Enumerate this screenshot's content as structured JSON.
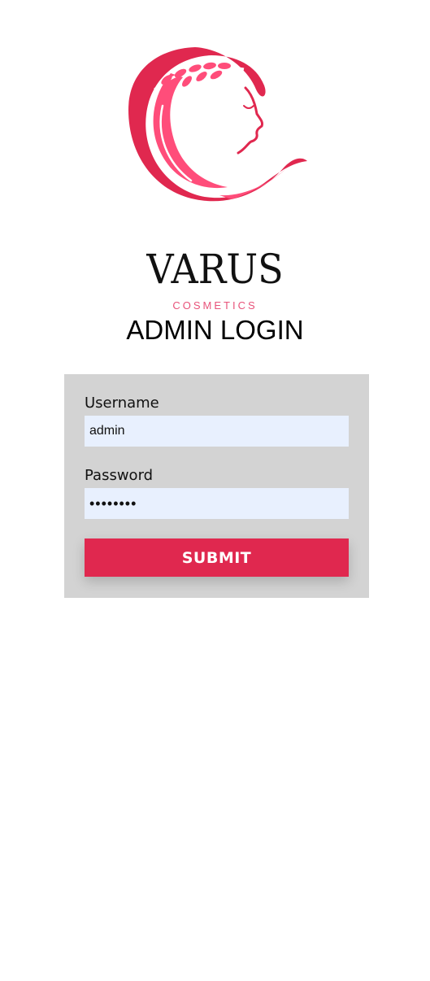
{
  "logo": {
    "name": "VARUS",
    "subtitle": "COSMETICS",
    "color_primary": "#e0284f",
    "color_light": "#ff4d7a"
  },
  "page": {
    "title": "ADMIN LOGIN"
  },
  "form": {
    "username": {
      "label": "Username",
      "value": "admin"
    },
    "password": {
      "label": "Password",
      "value": "••••••••"
    },
    "submit_label": "SUBMIT",
    "submit_color": "#e0284f",
    "card_color": "#d3d3d3",
    "input_bg": "#e8f0fe"
  }
}
